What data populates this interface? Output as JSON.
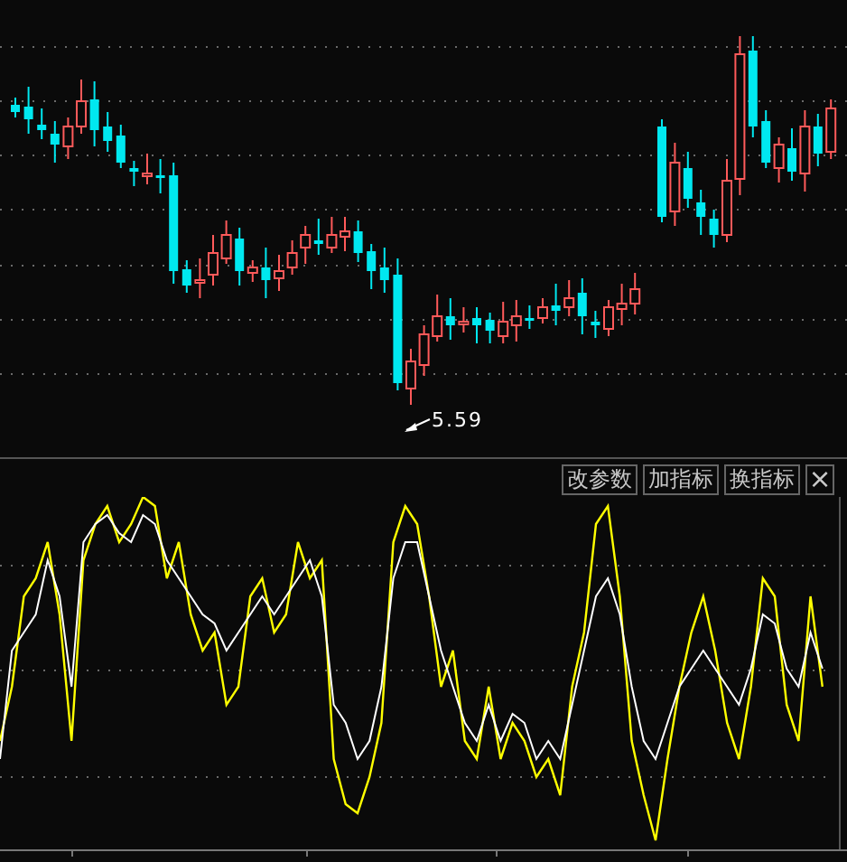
{
  "price_panel": {
    "low_label": "5.59"
  },
  "indicator_panel": {
    "buttons": [
      {
        "label": "改参数",
        "kind": "text"
      },
      {
        "label": "加指标",
        "kind": "text"
      },
      {
        "label": "换指标",
        "kind": "text"
      },
      {
        "label": "×",
        "kind": "close"
      }
    ]
  }
}
